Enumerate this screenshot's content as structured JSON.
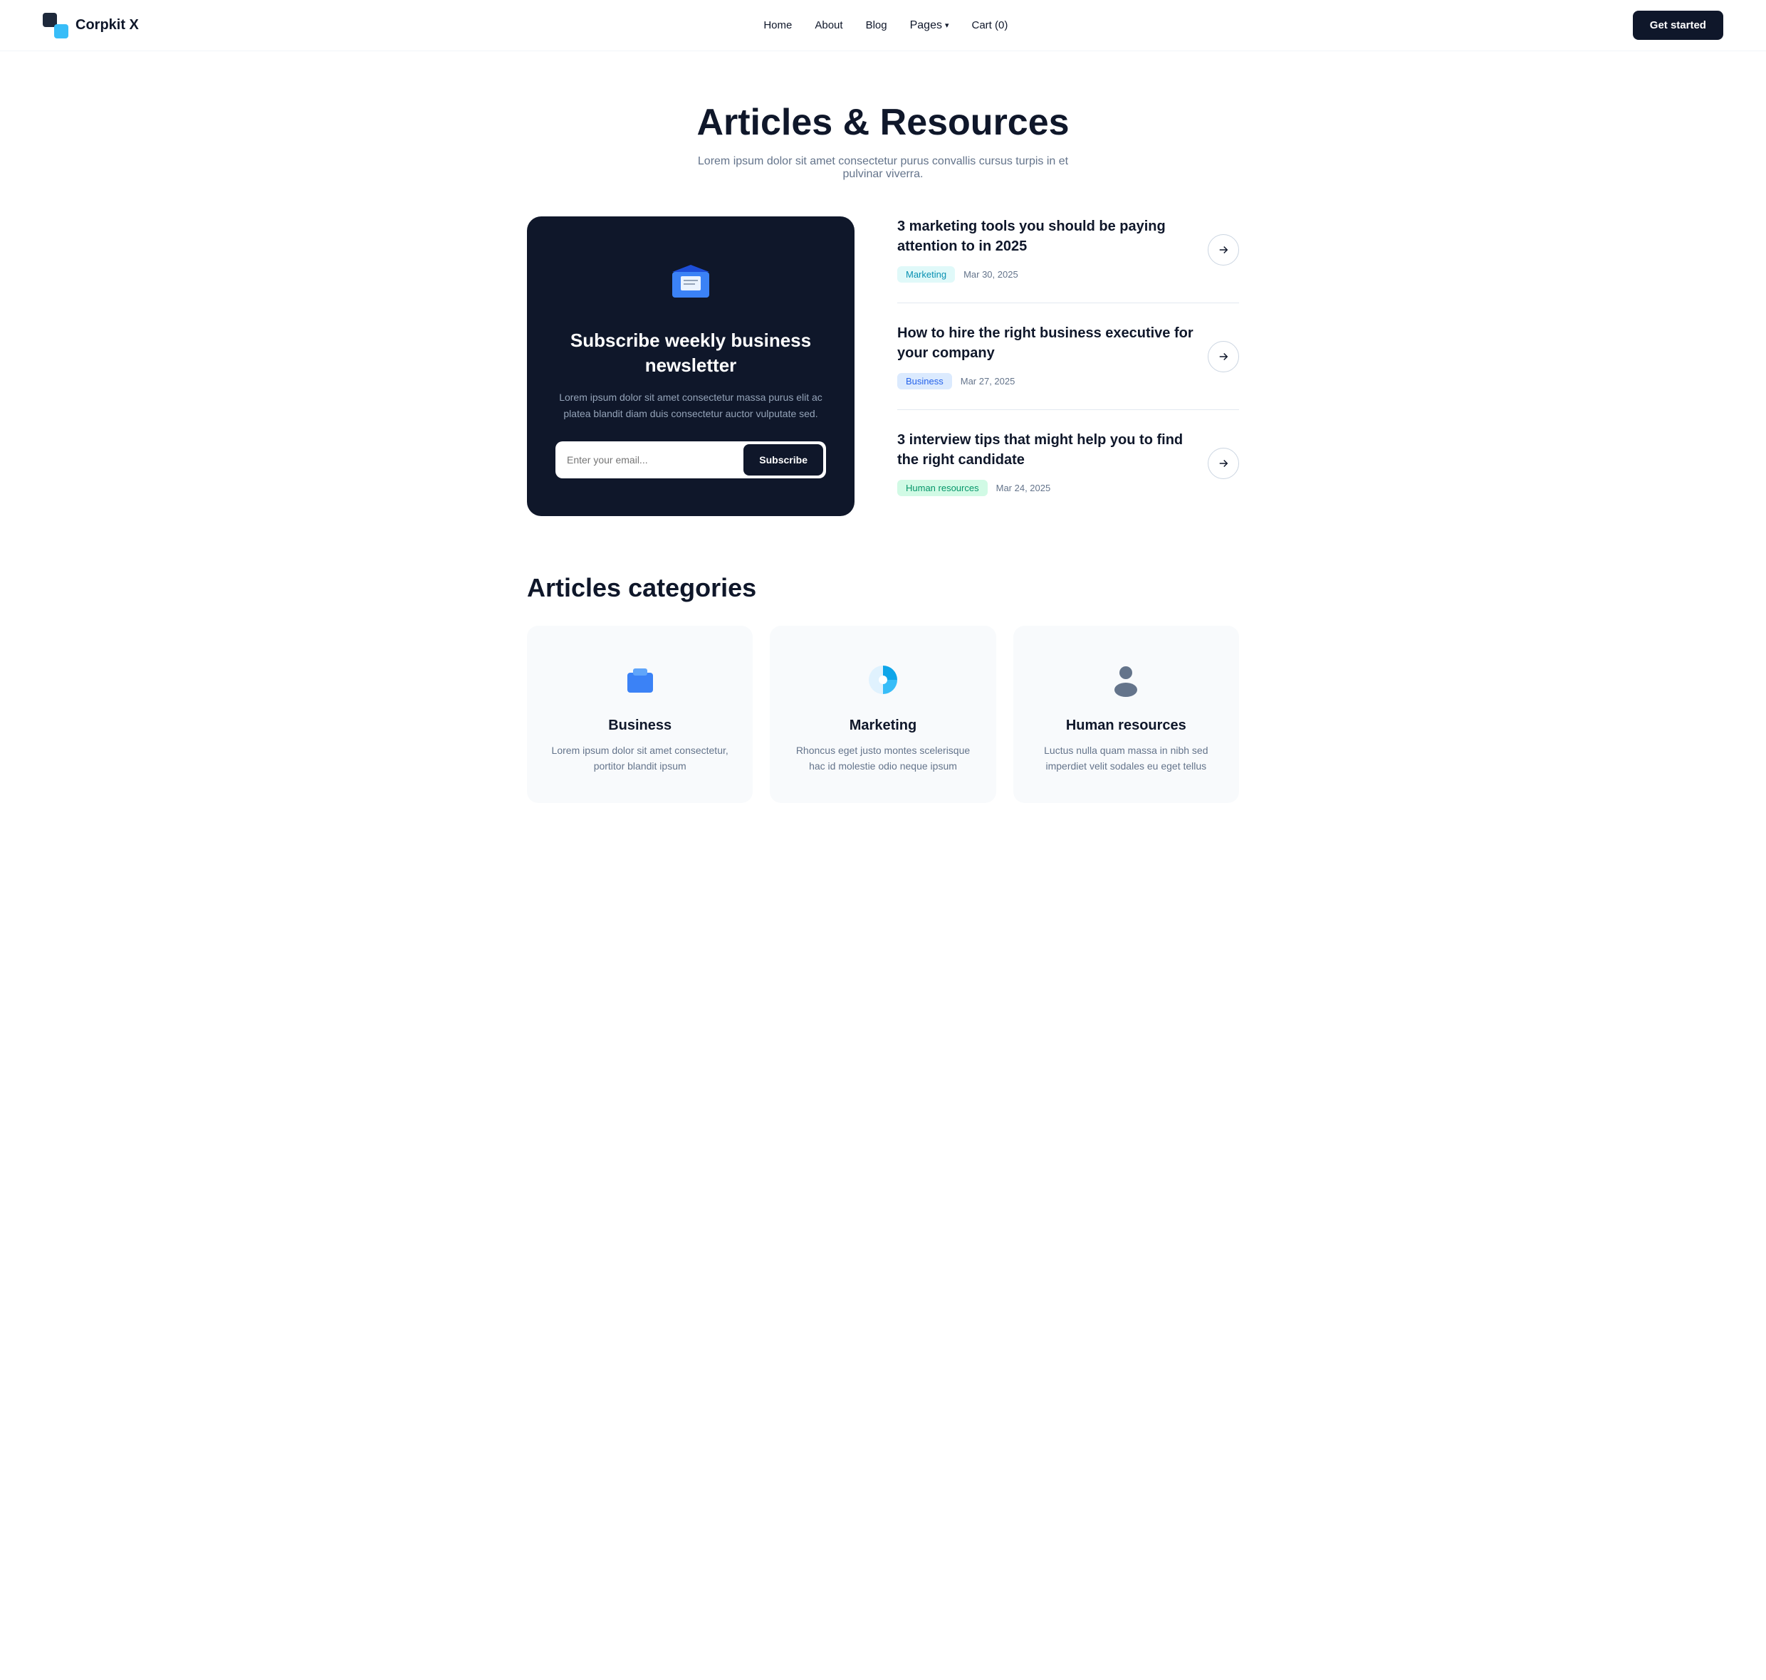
{
  "brand": {
    "name": "Corpkit X"
  },
  "nav": {
    "links": [
      {
        "label": "Home",
        "id": "home"
      },
      {
        "label": "About",
        "id": "about"
      },
      {
        "label": "Blog",
        "id": "blog"
      },
      {
        "label": "Pages",
        "id": "pages",
        "hasDropdown": true
      },
      {
        "label": "Cart (0)",
        "id": "cart"
      }
    ],
    "cta": "Get started"
  },
  "hero": {
    "title": "Articles & Resources",
    "subtitle": "Lorem ipsum dolor sit amet consectetur purus convallis cursus turpis in et pulvinar viverra."
  },
  "newsletter": {
    "title": "Subscribe weekly business newsletter",
    "description": "Lorem ipsum dolor sit amet consectetur massa purus elit ac platea blandit diam duis consectetur auctor vulputate sed.",
    "input_placeholder": "Enter your email...",
    "button_label": "Subscribe"
  },
  "articles": [
    {
      "title": "3 marketing tools you should be paying attention to in 2025",
      "tag": "Marketing",
      "tag_class": "tag-marketing",
      "date": "Mar 30, 2025"
    },
    {
      "title": "How to hire the right business executive for your company",
      "tag": "Business",
      "tag_class": "tag-business",
      "date": "Mar 27, 2025"
    },
    {
      "title": "3 interview tips that might help you to find the right candidate",
      "tag": "Human resources",
      "tag_class": "tag-hr",
      "date": "Mar 24, 2025"
    }
  ],
  "categories_section": {
    "title": "Articles categories"
  },
  "categories": [
    {
      "name": "Business",
      "description": "Lorem ipsum dolor sit amet consectetur, portitor blandit ipsum",
      "color": "#3b82f6"
    },
    {
      "name": "Marketing",
      "description": "Rhoncus eget justo montes scelerisque hac id molestie odio neque ipsum",
      "color": "#0ea5e9"
    },
    {
      "name": "Human resources",
      "description": "Luctus nulla quam massa in nibh sed imperdiet velit sodales eu eget tellus",
      "color": "#64748b"
    }
  ]
}
